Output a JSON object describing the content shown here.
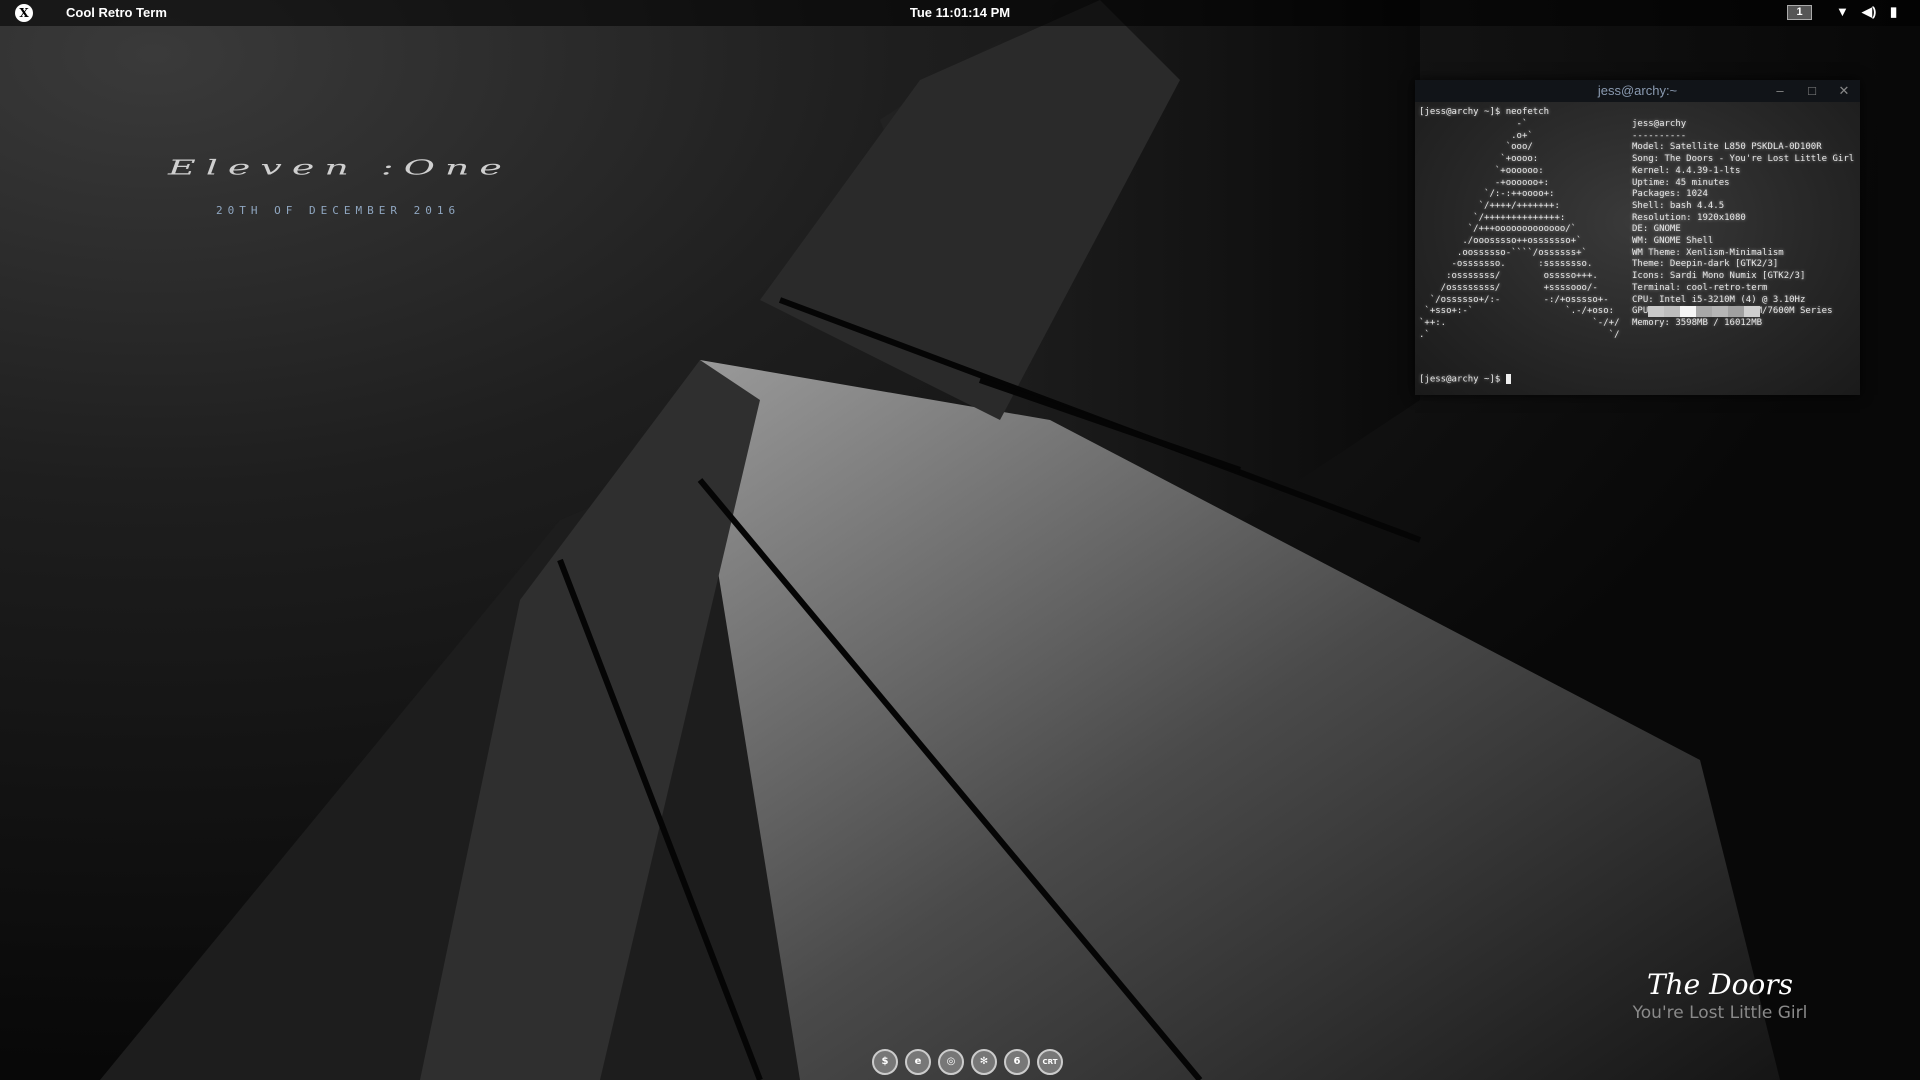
{
  "topbar": {
    "app_title": "Cool Retro Term",
    "clock": "Tue 11:01:14 PM",
    "workspace": "1",
    "icons": [
      "activities-logo-icon",
      "wifi-icon",
      "volume-icon",
      "battery-icon"
    ]
  },
  "wallpaper": {
    "title": "Eleven :One",
    "date": "20TH OF DECEMBER 2016"
  },
  "terminal": {
    "title": "jess@archy:~",
    "command_line": "[jess@archy ~]$ neofetch",
    "ascii_logo": "                  -`\n                 .o+`\n                `ooo/\n               `+oooo:\n              `+oooooo:\n              -+oooooo+:\n            `/:-:++oooo+:\n           `/++++/+++++++:\n          `/++++++++++++++:\n         `/+++ooooooooooooo/`\n        ./ooosssso++osssssso+`\n       .oossssso-````/ossssss+`\n      -osssssso.      :ssssssso.\n     :osssssss/        osssso+++.\n    /ossssssss/        +ssssooo/-\n  `/ossssso+/:-        -:/+osssso+-\n `+sso+:-`                 `.-/+oso:\n`++:.                           `-/+/\n.`                                 `/",
    "info": [
      "jess@archy",
      "----------",
      "Model: Satellite L850 PSKDLA-0D100R",
      "Song: The Doors - You're Lost Little Girl",
      "Kernel: 4.4.39-1-lts",
      "Uptime: 45 minutes",
      "Packages: 1024",
      "Shell: bash 4.4.5",
      "Resolution: 1920x1080",
      "DE: GNOME",
      "WM: GNOME Shell",
      "WM Theme: Xenlism-Minimalism",
      "Theme: Deepin-dark [GTK2/3]",
      "Icons: Sardi Mono Numix [GTK2/3]",
      "Terminal: cool-retro-term",
      "CPU: Intel i5-3210M (4) @ 3.10Hz",
      "GPU: AMD Radeon HD 7500M/7600M Series",
      "Memory: 3598MB / 16012MB"
    ],
    "palette": [
      "#c8c8c8",
      "#bdbdbd",
      "#f5f5f5",
      "#a8a8a8",
      "#b5b5b5",
      "#a0a0a0",
      "#cfcfcf"
    ],
    "prompt": "[jess@archy ~]$ "
  },
  "dock": [
    {
      "name": "terminal",
      "label": "$"
    },
    {
      "name": "firefox",
      "label": "e"
    },
    {
      "name": "chrome",
      "label": "◎"
    },
    {
      "name": "pinwheel",
      "label": "✻"
    },
    {
      "name": "spiral",
      "label": "6"
    },
    {
      "name": "cool-retro-term",
      "label": "CRT"
    }
  ],
  "now_playing": {
    "artist": "The Doors",
    "track": "You're Lost Little Girl"
  }
}
